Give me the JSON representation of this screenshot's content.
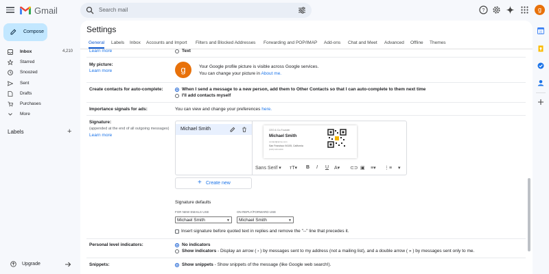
{
  "app": {
    "name": "Gmail"
  },
  "search": {
    "placeholder": "Search mail"
  },
  "account": {
    "initial": "g"
  },
  "compose": {
    "label": "Compose"
  },
  "nav": [
    {
      "label": "Inbox",
      "count": "4,210"
    },
    {
      "label": "Starred"
    },
    {
      "label": "Snoozed"
    },
    {
      "label": "Sent"
    },
    {
      "label": "Drafts"
    },
    {
      "label": "Purchases"
    },
    {
      "label": "More"
    }
  ],
  "labels": {
    "heading": "Labels"
  },
  "upgrade": {
    "label": "Upgrade"
  },
  "settings": {
    "title": "Settings",
    "tabs": [
      "General",
      "Labels",
      "Inbox",
      "Accounts and Import",
      "Filters and Blocked Addresses",
      "Forwarding and POP/IMAP",
      "Add-ons",
      "Chat and Meet",
      "Advanced",
      "Offline",
      "Themes"
    ],
    "active_tab": "General",
    "top": {
      "learn_more": "Learn more",
      "option": "Text"
    },
    "picture": {
      "label": "My picture:",
      "learn_more": "Learn more",
      "line1": "Your Google profile picture is visible across Google services.",
      "line2_prefix": "You can change your picture in",
      "line2_link": "About me."
    },
    "contacts": {
      "label": "Create contacts for auto-complete:",
      "opt1": "When I send a message to a new person, add them to Other Contacts so that I can auto-complete to them next time",
      "opt2": "I'll add contacts myself"
    },
    "importance": {
      "label": "Importance signals for ads:",
      "text_prefix": "You can view and change your preferences",
      "text_link": "here."
    },
    "signature": {
      "label": "Signature:",
      "sublabel": "(appended at the end of all outgoing messages)",
      "learn_more": "Learn more",
      "items": [
        {
          "name": "Michael Smith"
        }
      ],
      "card": {
        "header": "CEO & Co-Founder",
        "name": "Michael Smith",
        "email": "contact@acme.com",
        "address": "San Francisco 94105, California",
        "phone": "(123) 123-1234"
      },
      "toolbar": {
        "font": "Sans Serif"
      },
      "create_new": "Create new",
      "defaults_title": "Signature defaults",
      "new_emails_label": "FOR NEW EMAILS USE",
      "reply_label": "ON REPLY/FORWARD USE",
      "new_emails_value": "Michael Smith",
      "reply_value": "Michael Smith",
      "insert_before": "Insert signature before quoted text in replies and remove the \"--\" line that precedes it."
    },
    "personal": {
      "label": "Personal level indicators:",
      "opt1": "No indicators",
      "opt2_bold": "Show indicators",
      "opt2_rest": " - Display an arrow ( › ) by messages sent to my address (not a mailing list), and a double arrow ( » ) by messages sent only to me."
    },
    "snippets": {
      "label": "Snippets:",
      "opt1_bold": "Show snippets",
      "opt1_rest": " - Show snippets of the message (like Google web search!)."
    }
  },
  "colors": {
    "accent": "#0b57d0",
    "compose_bg": "#c2e7ff",
    "avatar": "#e8710a",
    "page_bg": "#f6f8fc"
  }
}
